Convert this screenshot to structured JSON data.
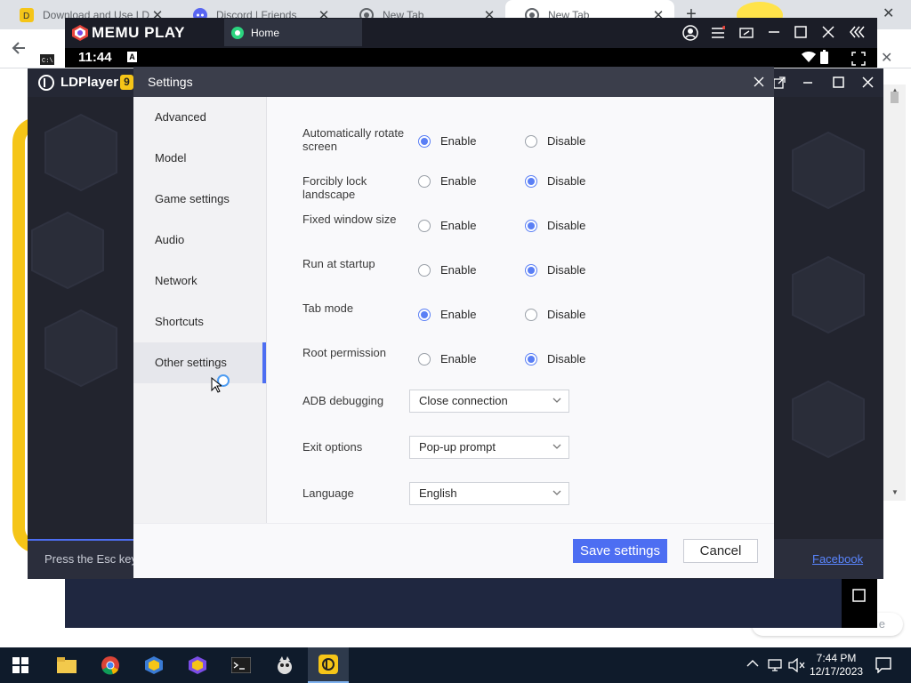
{
  "browser": {
    "tabs": [
      {
        "title": "Download and Use LD"
      },
      {
        "title": "Discord | Friends"
      },
      {
        "title": "New Tab"
      },
      {
        "title": "New Tab"
      }
    ],
    "new_tab_label": "+",
    "status_hint": "e"
  },
  "memu": {
    "brand": "MEMU PLAY",
    "tab_label": "Home",
    "time": "11:44",
    "status_badge": "A"
  },
  "ldplayer": {
    "brand": "LDPlayer",
    "version_badge": "9",
    "footer_text": "Press the Esc key",
    "footer_link": "Facebook"
  },
  "settings": {
    "title": "Settings",
    "nav": [
      {
        "label": "Advanced"
      },
      {
        "label": "Model"
      },
      {
        "label": "Game settings"
      },
      {
        "label": "Audio"
      },
      {
        "label": "Network"
      },
      {
        "label": "Shortcuts"
      },
      {
        "label": "Other settings",
        "active": true
      }
    ],
    "enable_label": "Enable",
    "disable_label": "Disable",
    "options": [
      {
        "label": "Automatically rotate screen",
        "value": "Enable"
      },
      {
        "label": "Forcibly lock landscape",
        "value": "Disable"
      },
      {
        "label": "Fixed window size",
        "value": "Disable"
      },
      {
        "label": "Run at startup",
        "value": "Disable"
      },
      {
        "label": "Tab mode",
        "value": "Enable"
      },
      {
        "label": "Root permission",
        "value": "Disable"
      }
    ],
    "selects": [
      {
        "label": "ADB debugging",
        "value": "Close connection"
      },
      {
        "label": "Exit options",
        "value": "Pop-up prompt"
      },
      {
        "label": "Language",
        "value": "English"
      }
    ],
    "save_label": "Save settings",
    "cancel_label": "Cancel"
  },
  "taskbar": {
    "time": "7:44 PM",
    "date": "12/17/2023"
  },
  "colors": {
    "accent": "#4d6ef2",
    "dialog_header": "#3b3e4b",
    "taskbar": "#0f1b2b"
  }
}
